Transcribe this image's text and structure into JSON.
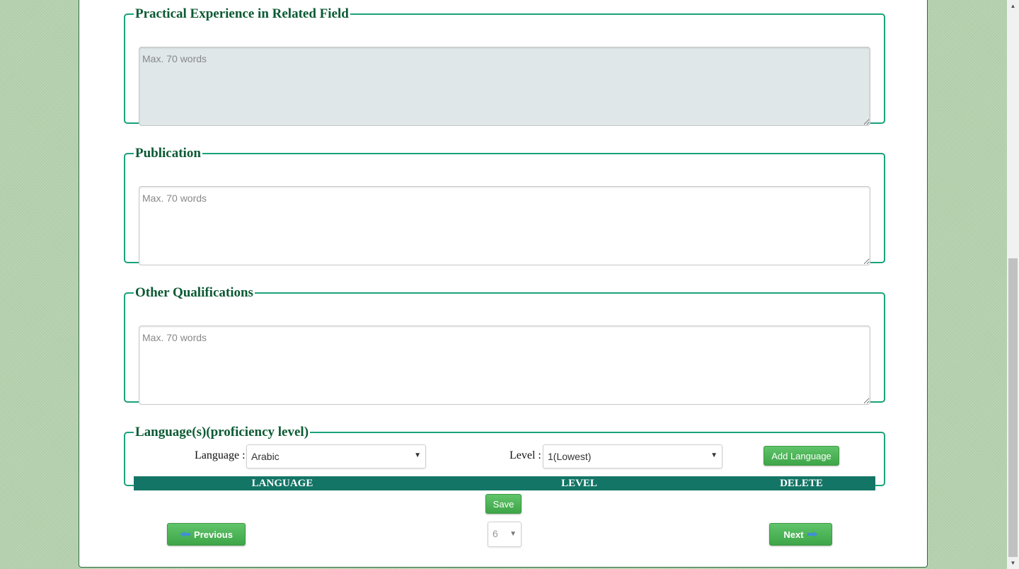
{
  "sections": {
    "practical": {
      "legend": "Practical Experience in Related Field",
      "placeholder": "Max. 70 words"
    },
    "publication": {
      "legend": "Publication",
      "placeholder": "Max. 70 words"
    },
    "other": {
      "legend": "Other Qualifications",
      "placeholder": "Max. 70 words"
    }
  },
  "languages": {
    "legend": "Language(s)(proficiency level)",
    "language_label": "Language :",
    "language_value": "Arabic",
    "level_label": "Level :",
    "level_value": "1(Lowest)",
    "add_button": "Add Language",
    "columns": [
      "LANGUAGE",
      "LEVEL",
      "DELETE"
    ]
  },
  "actions": {
    "save": "Save",
    "previous": "Previous",
    "next": "Next",
    "page_value": "6"
  },
  "colors": {
    "accent": "#1aa27a",
    "header": "#137566",
    "button": "#4cb556",
    "legend": "#0b5a33"
  }
}
